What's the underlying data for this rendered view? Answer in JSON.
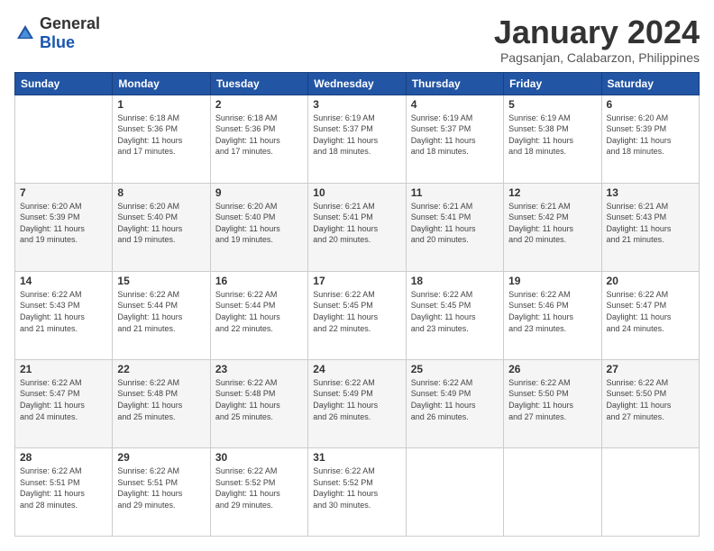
{
  "header": {
    "logo_general": "General",
    "logo_blue": "Blue",
    "month": "January 2024",
    "location": "Pagsanjan, Calabarzon, Philippines"
  },
  "days": [
    "Sunday",
    "Monday",
    "Tuesday",
    "Wednesday",
    "Thursday",
    "Friday",
    "Saturday"
  ],
  "weeks": [
    [
      {
        "day": "",
        "info": ""
      },
      {
        "day": "1",
        "info": "Sunrise: 6:18 AM\nSunset: 5:36 PM\nDaylight: 11 hours\nand 17 minutes."
      },
      {
        "day": "2",
        "info": "Sunrise: 6:18 AM\nSunset: 5:36 PM\nDaylight: 11 hours\nand 17 minutes."
      },
      {
        "day": "3",
        "info": "Sunrise: 6:19 AM\nSunset: 5:37 PM\nDaylight: 11 hours\nand 18 minutes."
      },
      {
        "day": "4",
        "info": "Sunrise: 6:19 AM\nSunset: 5:37 PM\nDaylight: 11 hours\nand 18 minutes."
      },
      {
        "day": "5",
        "info": "Sunrise: 6:19 AM\nSunset: 5:38 PM\nDaylight: 11 hours\nand 18 minutes."
      },
      {
        "day": "6",
        "info": "Sunrise: 6:20 AM\nSunset: 5:39 PM\nDaylight: 11 hours\nand 18 minutes."
      }
    ],
    [
      {
        "day": "7",
        "info": ""
      },
      {
        "day": "8",
        "info": "Sunrise: 6:20 AM\nSunset: 5:40 PM\nDaylight: 11 hours\nand 19 minutes."
      },
      {
        "day": "9",
        "info": "Sunrise: 6:20 AM\nSunset: 5:40 PM\nDaylight: 11 hours\nand 19 minutes."
      },
      {
        "day": "10",
        "info": "Sunrise: 6:21 AM\nSunset: 5:41 PM\nDaylight: 11 hours\nand 20 minutes."
      },
      {
        "day": "11",
        "info": "Sunrise: 6:21 AM\nSunset: 5:41 PM\nDaylight: 11 hours\nand 20 minutes."
      },
      {
        "day": "12",
        "info": "Sunrise: 6:21 AM\nSunset: 5:42 PM\nDaylight: 11 hours\nand 20 minutes."
      },
      {
        "day": "13",
        "info": "Sunrise: 6:21 AM\nSunset: 5:43 PM\nDaylight: 11 hours\nand 21 minutes."
      }
    ],
    [
      {
        "day": "14",
        "info": ""
      },
      {
        "day": "15",
        "info": "Sunrise: 6:22 AM\nSunset: 5:44 PM\nDaylight: 11 hours\nand 21 minutes."
      },
      {
        "day": "16",
        "info": "Sunrise: 6:22 AM\nSunset: 5:44 PM\nDaylight: 11 hours\nand 22 minutes."
      },
      {
        "day": "17",
        "info": "Sunrise: 6:22 AM\nSunset: 5:45 PM\nDaylight: 11 hours\nand 22 minutes."
      },
      {
        "day": "18",
        "info": "Sunrise: 6:22 AM\nSunset: 5:45 PM\nDaylight: 11 hours\nand 23 minutes."
      },
      {
        "day": "19",
        "info": "Sunrise: 6:22 AM\nSunset: 5:46 PM\nDaylight: 11 hours\nand 23 minutes."
      },
      {
        "day": "20",
        "info": "Sunrise: 6:22 AM\nSunset: 5:47 PM\nDaylight: 11 hours\nand 24 minutes."
      }
    ],
    [
      {
        "day": "21",
        "info": ""
      },
      {
        "day": "22",
        "info": "Sunrise: 6:22 AM\nSunset: 5:48 PM\nDaylight: 11 hours\nand 25 minutes."
      },
      {
        "day": "23",
        "info": "Sunrise: 6:22 AM\nSunset: 5:48 PM\nDaylight: 11 hours\nand 25 minutes."
      },
      {
        "day": "24",
        "info": "Sunrise: 6:22 AM\nSunset: 5:49 PM\nDaylight: 11 hours\nand 26 minutes."
      },
      {
        "day": "25",
        "info": "Sunrise: 6:22 AM\nSunset: 5:49 PM\nDaylight: 11 hours\nand 26 minutes."
      },
      {
        "day": "26",
        "info": "Sunrise: 6:22 AM\nSunset: 5:50 PM\nDaylight: 11 hours\nand 27 minutes."
      },
      {
        "day": "27",
        "info": "Sunrise: 6:22 AM\nSunset: 5:50 PM\nDaylight: 11 hours\nand 27 minutes."
      }
    ],
    [
      {
        "day": "28",
        "info": ""
      },
      {
        "day": "29",
        "info": "Sunrise: 6:22 AM\nSunset: 5:51 PM\nDaylight: 11 hours\nand 29 minutes."
      },
      {
        "day": "30",
        "info": "Sunrise: 6:22 AM\nSunset: 5:52 PM\nDaylight: 11 hours\nand 29 minutes."
      },
      {
        "day": "31",
        "info": "Sunrise: 6:22 AM\nSunset: 5:52 PM\nDaylight: 11 hours\nand 30 minutes."
      },
      {
        "day": "",
        "info": ""
      },
      {
        "day": "",
        "info": ""
      },
      {
        "day": "",
        "info": ""
      }
    ]
  ],
  "week1_day7_info": "Sunrise: 6:20 AM\nSunset: 5:39 PM\nDaylight: 11 hours\nand 19 minutes.",
  "week2_day14_info": "Sunrise: 6:22 AM\nSunset: 5:43 PM\nDaylight: 11 hours\nand 21 minutes.",
  "week3_day21_info": "Sunrise: 6:22 AM\nSunset: 5:47 PM\nDaylight: 11 hours\nand 24 minutes.",
  "week4_day28_info": "Sunrise: 6:22 AM\nSunset: 5:51 PM\nDaylight: 11 hours\nand 28 minutes."
}
